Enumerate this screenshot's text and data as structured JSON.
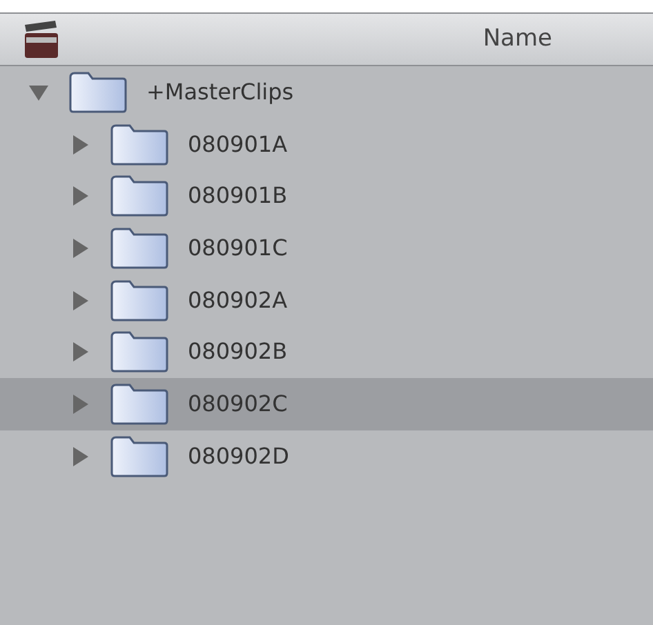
{
  "header": {
    "column_1": "Name"
  },
  "tree": [
    {
      "label": "+MasterClips",
      "expanded": true,
      "selected": false,
      "children": [
        {
          "label": "080901A",
          "expanded": false,
          "selected": false
        },
        {
          "label": "080901B",
          "expanded": false,
          "selected": false
        },
        {
          "label": "080901C",
          "expanded": false,
          "selected": false
        },
        {
          "label": "080902A",
          "expanded": false,
          "selected": false
        },
        {
          "label": "080902B",
          "expanded": false,
          "selected": false
        },
        {
          "label": "080902C",
          "expanded": false,
          "selected": true
        },
        {
          "label": "080902D",
          "expanded": false,
          "selected": false
        }
      ]
    }
  ]
}
